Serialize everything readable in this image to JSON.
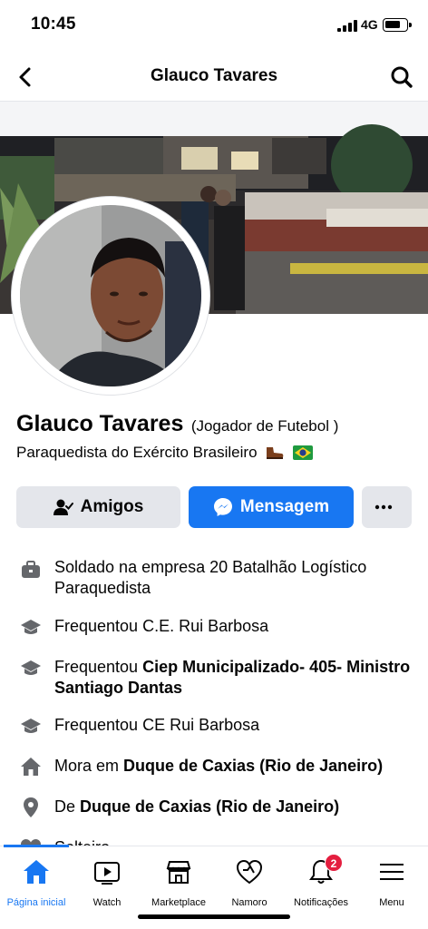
{
  "status_bar": {
    "time": "10:45",
    "network": "4G"
  },
  "header": {
    "title": "Glauco Tavares",
    "back_icon": "chevron-left-icon",
    "search_icon": "search-icon"
  },
  "profile": {
    "name": "Glauco Tavares",
    "subtitle": "(Jogador de Futebol )",
    "bio": "Paraquedista do Exército Brasileiro",
    "bio_emojis": [
      "boot-emoji",
      "brazil-flag-emoji"
    ]
  },
  "actions": {
    "friends_label": "Amigos",
    "message_label": "Mensagem",
    "more_icon": "more-dots-icon",
    "message_color": "#1877f2"
  },
  "info": {
    "work": {
      "prefix": "Soldado na empresa 20 Batalhão Logístico Paraquedista"
    },
    "edu1": {
      "prefix": "Frequentou C.E. Rui Barbosa"
    },
    "edu2": {
      "prefix": "Frequentou",
      "bold": "Ciep Municipalizado- 405- Ministro Santiago Dantas"
    },
    "edu3": {
      "prefix": "Frequentou CE Rui Barbosa"
    },
    "lives": {
      "prefix": "Mora em",
      "bold": "Duque de Caxias (Rio de Janeiro)"
    },
    "from": {
      "prefix": "De",
      "bold": "Duque de Caxias (Rio de Janeiro)"
    },
    "relationship": {
      "prefix": "Solteiro"
    }
  },
  "bottom_nav": {
    "tabs": [
      {
        "label": "Página inicial",
        "icon": "home-icon",
        "active": true
      },
      {
        "label": "Watch",
        "icon": "watch-icon"
      },
      {
        "label": "Marketplace",
        "icon": "marketplace-icon"
      },
      {
        "label": "Namoro",
        "icon": "dating-heart-icon"
      },
      {
        "label": "Notificações",
        "icon": "bell-icon",
        "badge": "2"
      },
      {
        "label": "Menu",
        "icon": "menu-icon"
      }
    ]
  }
}
